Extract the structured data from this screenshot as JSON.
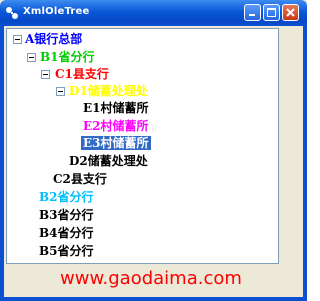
{
  "window": {
    "title": "XmlOleTree"
  },
  "tree": {
    "root": {
      "label": "A银行总部"
    },
    "b1": {
      "label": "B1省分行"
    },
    "c1": {
      "label": "C1县支行"
    },
    "d1": {
      "label": "D1储蓄处理处"
    },
    "e1": {
      "label": "E1村储蓄所"
    },
    "e2": {
      "label": "E2村储蓄所"
    },
    "e3": {
      "label": "E3村储蓄所"
    },
    "d2": {
      "label": "D2储蓄处理处"
    },
    "c2": {
      "label": "C2县支行"
    },
    "b2": {
      "label": "B2省分行"
    },
    "b3": {
      "label": "B3省分行"
    },
    "b4": {
      "label": "B4省分行"
    },
    "b5": {
      "label": "B5省分行"
    }
  },
  "watermark": "www.gaodaima.com",
  "colors": {
    "root": "#0000ff",
    "b1": "#00cc00",
    "c1": "#ff0000",
    "d1": "#ffff00",
    "e2": "#ff00ff",
    "b2": "#00bfff",
    "selection": "#316ac5"
  }
}
